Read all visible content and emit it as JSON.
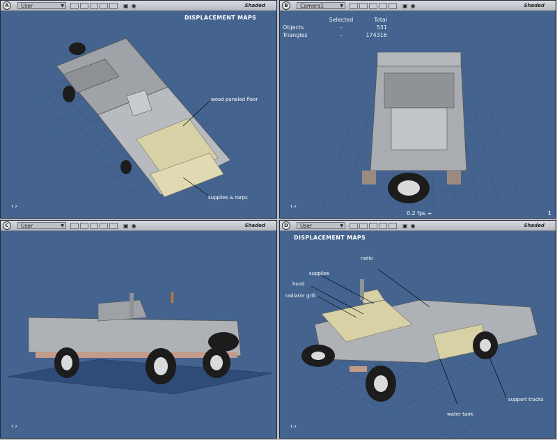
{
  "colors": {
    "viewport_bg": "#44648f",
    "grid": "#2f4b78",
    "model": "#b8bbbf",
    "highlight": "#d9d2a8",
    "frame": "#434a58"
  },
  "viewports": {
    "a": {
      "letter": "A",
      "camera": "User",
      "shading": "Shaded",
      "title": "DISPLACEMENT MAPS",
      "annotations": [
        "wood paneled floor",
        "supplies & tarps"
      ]
    },
    "b": {
      "letter": "B",
      "camera": "Camera1",
      "shading": "Shaded",
      "stats": {
        "col_selected": "Selected",
        "col_total": "Total",
        "objects_label": "Objects",
        "objects_selected": "-",
        "objects_total": "531",
        "triangles_label": "Triangles",
        "triangles_selected": "-",
        "triangles_total": "174316"
      },
      "fps": "0.2  fps  +",
      "number": "1"
    },
    "c": {
      "letter": "C",
      "camera": "User",
      "shading": "Shaded"
    },
    "d": {
      "letter": "D",
      "camera": "User",
      "shading": "Shaded",
      "title": "DISPLACEMENT MAPS",
      "annotations": [
        "radio",
        "supplies",
        "hood",
        "radiator grill",
        "water tank",
        "support tracks"
      ]
    }
  },
  "icons": {
    "dropdown": "chevron-down-icon",
    "render": "render-icon",
    "eye": "eye-icon",
    "axis": "axis-gizmo-icon"
  }
}
